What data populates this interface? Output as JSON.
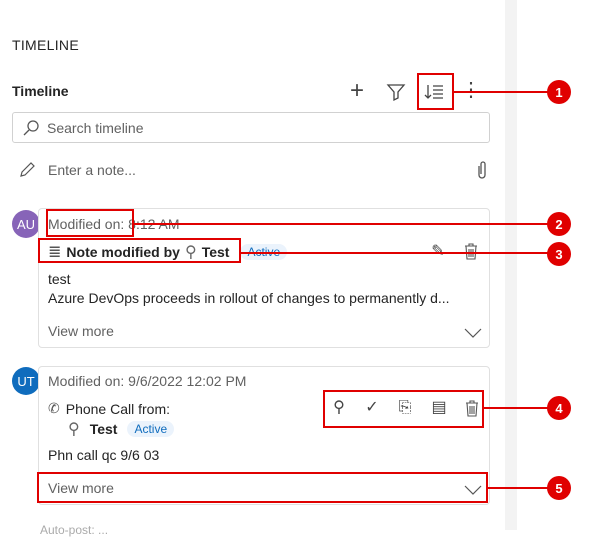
{
  "section_title": "TIMELINE",
  "header": {
    "title": "Timeline",
    "icons": [
      "plus-icon",
      "filter-icon",
      "sort-icon",
      "more-icon"
    ]
  },
  "search": {
    "placeholder": "Search timeline"
  },
  "note": {
    "placeholder": "Enter a note..."
  },
  "cards": [
    {
      "avatar": "AU",
      "avatar_color": "#8764b8",
      "modified_label": "Modified on:",
      "modified_time": "8:12 AM",
      "title": "Note modified by",
      "user": "Test",
      "status": "Active",
      "body1": "test",
      "body2": "Azure DevOps proceeds in rollout of changes to permanently d...",
      "view_more": "View more"
    },
    {
      "avatar": "UT",
      "avatar_color": "#0f6cbd",
      "modified": "Modified on: 9/6/2022 12:02 PM",
      "title": "Phone Call from:",
      "user": "Test",
      "status": "Active",
      "body1": "Phn call qc 9/6 03",
      "view_more": "View more"
    }
  ],
  "next_item": "Auto-post: ...",
  "callouts": [
    "1",
    "2",
    "3",
    "4",
    "5"
  ],
  "colors": {
    "callout": "#e00000",
    "accent": "#0f6cbd"
  }
}
